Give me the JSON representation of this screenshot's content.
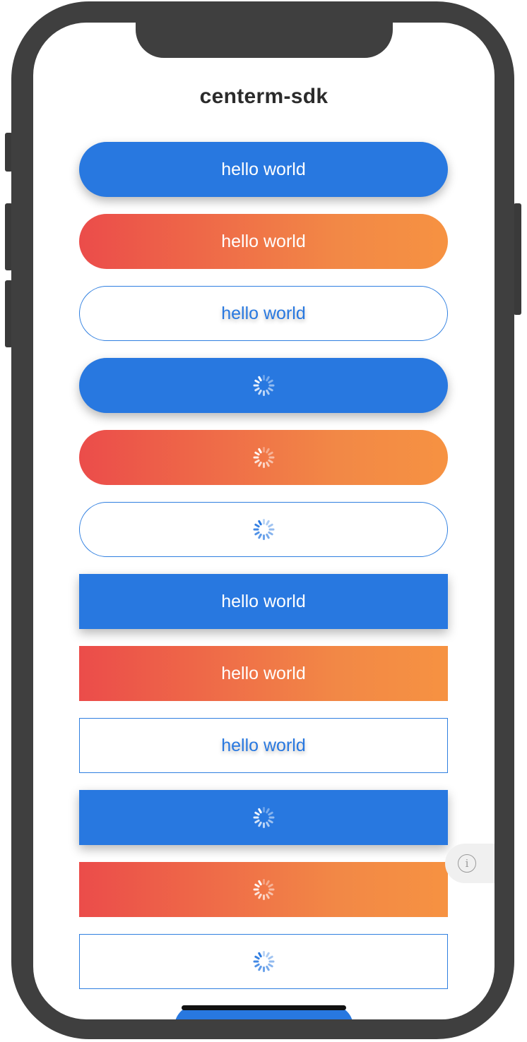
{
  "app": {
    "title": "centerm-sdk"
  },
  "buttons": [
    {
      "label": "hello world",
      "style": "primary",
      "shape": "round",
      "loading": false
    },
    {
      "label": "hello world",
      "style": "gradient",
      "shape": "round",
      "loading": false
    },
    {
      "label": "hello world",
      "style": "outline",
      "shape": "round",
      "loading": false
    },
    {
      "label": "",
      "style": "primary",
      "shape": "round",
      "loading": true
    },
    {
      "label": "",
      "style": "gradient",
      "shape": "round",
      "loading": true
    },
    {
      "label": "",
      "style": "outline",
      "shape": "round",
      "loading": true
    },
    {
      "label": "hello world",
      "style": "primary",
      "shape": "square",
      "loading": false
    },
    {
      "label": "hello world",
      "style": "gradient",
      "shape": "square",
      "loading": false
    },
    {
      "label": "hello world",
      "style": "outline",
      "shape": "square",
      "loading": false
    },
    {
      "label": "",
      "style": "primary",
      "shape": "square",
      "loading": true
    },
    {
      "label": "",
      "style": "gradient",
      "shape": "square",
      "loading": true
    },
    {
      "label": "",
      "style": "outline",
      "shape": "square",
      "loading": true
    }
  ],
  "info_tab": {
    "icon": "info-icon",
    "glyph": "i"
  },
  "colors": {
    "primary": "#2878e0",
    "gradient_start": "#eb4c4a",
    "gradient_end": "#f69242",
    "frame": "#3f3f3f"
  }
}
